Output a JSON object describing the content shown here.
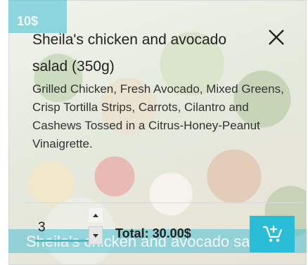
{
  "product": {
    "price": "10$",
    "title": "Sheila's chicken and avocado salad (350g)",
    "description": "Grilled Chicken, Fresh Avocado, Mixed Greens, Crisp Tortilla Strips, Carrots, Cilantro and Cashews Tossed in a Citrus-Honey-Peanut Vinaigrette.",
    "bottom_name": "Sheila's chicken and avocado salad"
  },
  "order": {
    "quantity": "3",
    "total_label": "Total: 30.00$"
  },
  "icons": {
    "close": "close-icon",
    "spin_up": "chevron-up-icon",
    "spin_down": "chevron-down-icon",
    "cart": "add-to-cart-icon"
  },
  "colors": {
    "accent": "#2bbcd8",
    "text": "#222222"
  }
}
